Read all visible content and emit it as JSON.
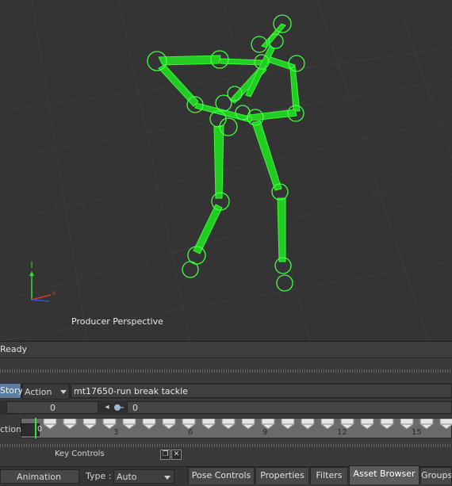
{
  "viewport": {
    "label": "Producer Perspective"
  },
  "status": {
    "text": "Ready"
  },
  "story": {
    "story_label": "Story",
    "action_label": "Action",
    "take_name": "mt17650-run break tackle"
  },
  "values": {
    "left_value": "0",
    "right_value": "0"
  },
  "timeline": {
    "label": "ction",
    "start_frame": "0",
    "ticks": [
      "3",
      "6",
      "9",
      "12",
      "15"
    ]
  },
  "key_controls": {
    "label": "Key Controls"
  },
  "bottom": {
    "animation_label": "Animation",
    "type_label": "Type :",
    "type_value": "Auto",
    "tabs": [
      "Pose Controls",
      "Properties",
      "Filters",
      "Asset Browser",
      "Groups"
    ],
    "active_tab": "Asset Browser"
  },
  "colors": {
    "skeleton": "#22dd22",
    "accent": "#5b7e9c",
    "cursor": "#39e239"
  }
}
